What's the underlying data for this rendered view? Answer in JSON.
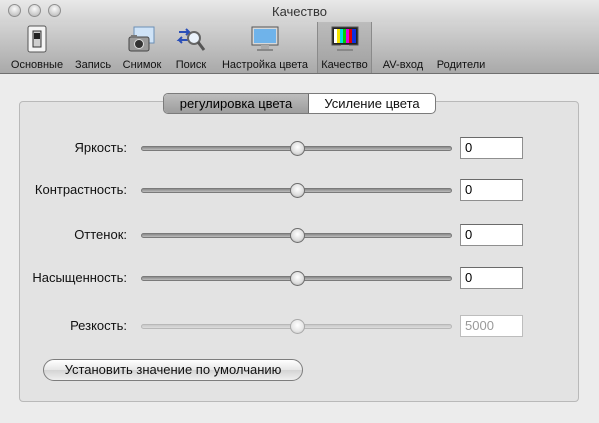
{
  "window": {
    "title": "Качество"
  },
  "toolbar": {
    "items": [
      {
        "label": "Основные",
        "icon": "switch-icon"
      },
      {
        "label": "Запись",
        "icon": "record-icon"
      },
      {
        "label": "Снимок",
        "icon": "camera-icon"
      },
      {
        "label": "Поиск",
        "icon": "search-icon"
      },
      {
        "label": "Настройка цвета",
        "icon": "monitor-icon"
      },
      {
        "label": "Качество",
        "icon": "color-bars-icon",
        "selected": true
      },
      {
        "label": "AV-вход",
        "icon": ""
      },
      {
        "label": "Родители",
        "icon": ""
      }
    ]
  },
  "tabs": [
    {
      "label": "регулировка цвета",
      "active": true
    },
    {
      "label": "Усиление цвета",
      "active": false
    }
  ],
  "controls": [
    {
      "label": "Яркость:",
      "value": "0",
      "level": 0.5,
      "enabled": true
    },
    {
      "label": "Контрастность:",
      "value": "0",
      "level": 0.5,
      "enabled": true
    },
    {
      "label": "Оттенок:",
      "value": "0",
      "level": 0.5,
      "enabled": true
    },
    {
      "label": "Насыщенность:",
      "value": "0",
      "level": 0.5,
      "enabled": true
    },
    {
      "label": "Резкость:",
      "value": "5000",
      "level": 0.5,
      "enabled": false
    }
  ],
  "reset_button": {
    "label": "Установить значение по умолчанию"
  },
  "colors": {
    "accent_selected_tab": "#a6a6a6",
    "disabled_text": "#9a9a9a"
  }
}
